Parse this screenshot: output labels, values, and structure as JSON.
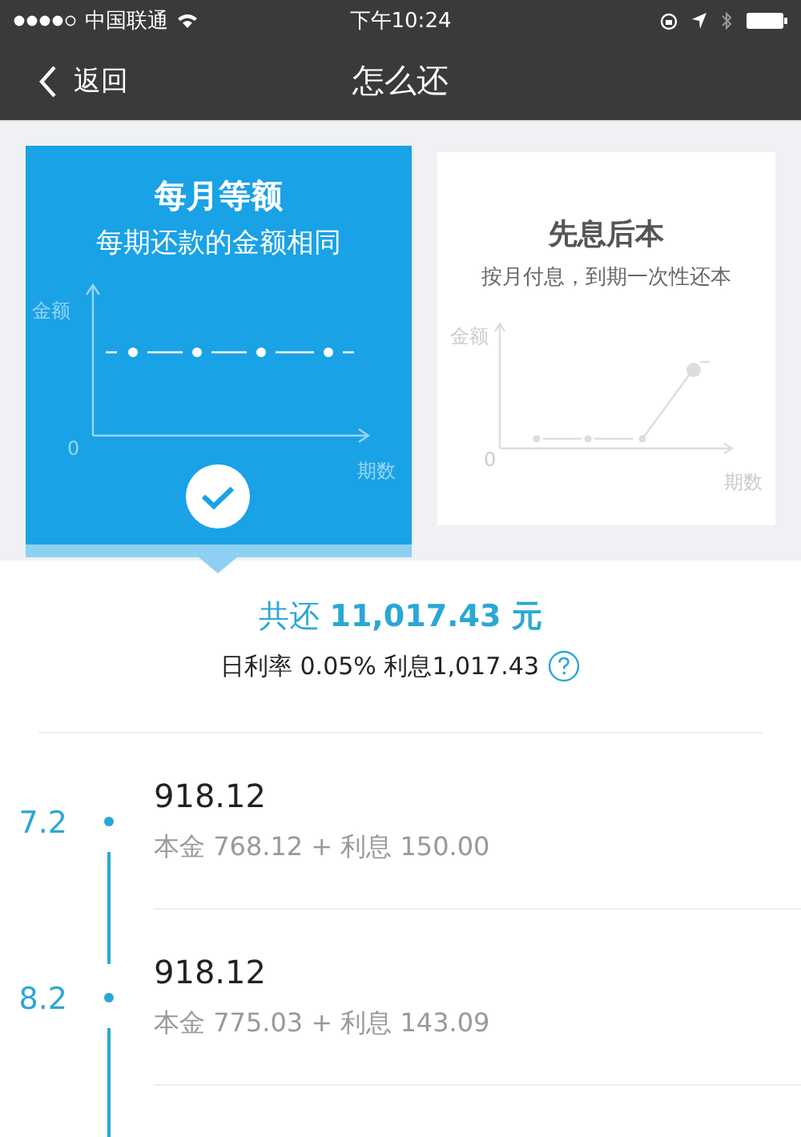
{
  "status_bar": {
    "carrier": "中国联通",
    "time": "下午10:24"
  },
  "nav": {
    "back": "返回",
    "title": "怎么还"
  },
  "plans": [
    {
      "kind": "equal",
      "title": "每月等额",
      "subtitle": "每期还款的金额相同",
      "y_axis": "金额",
      "origin": "0",
      "x_axis": "期数",
      "selected": true
    },
    {
      "kind": "interest_first",
      "title": "先息后本",
      "subtitle": "按月付息，到期一次性还本",
      "y_axis": "金额",
      "origin": "0",
      "x_axis": "期数",
      "selected": false
    }
  ],
  "summary": {
    "total": "共还 **11,017.43 元**",
    "detail": "日利率 0.05% 利息1,017.43"
  },
  "schedule": [
    {
      "date": "7.2",
      "amount": "918.12",
      "breakdown": "本金 768.12 + 利息 150.00"
    },
    {
      "date": "8.2",
      "amount": "918.12",
      "breakdown": "本金 775.03 + 利息 143.09"
    }
  ]
}
